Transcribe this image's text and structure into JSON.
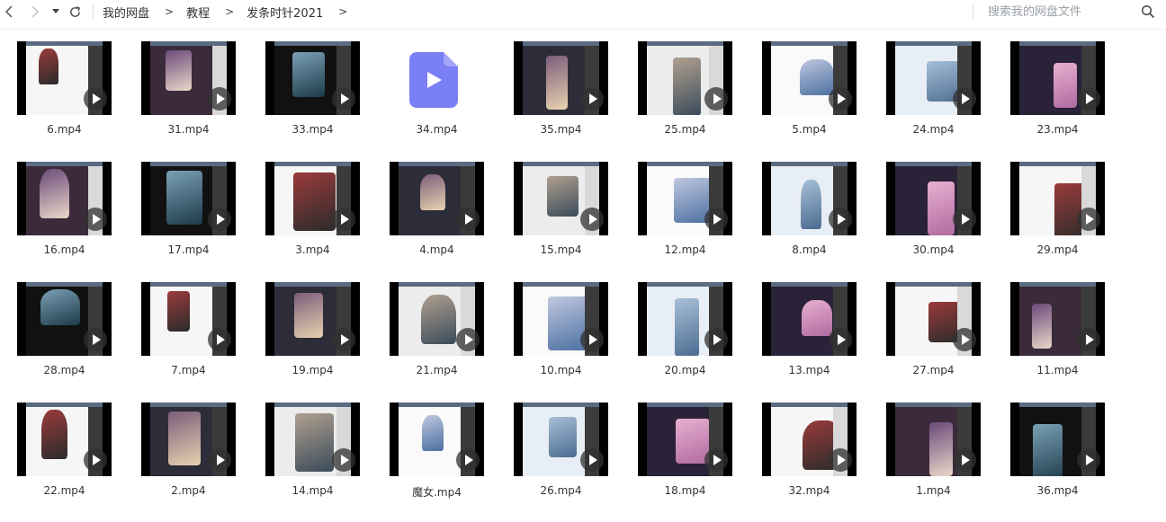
{
  "toolbar": {
    "back_icon": "chevron-left-icon",
    "forward_icon": "chevron-right-icon",
    "history_icon": "caret-down-icon",
    "refresh_icon": "refresh-icon",
    "breadcrumb": [
      "我的网盘",
      "教程",
      "发条时针2021"
    ],
    "breadcrumb_sep": ">",
    "search_placeholder": "搜索我的网盘文件",
    "search_icon": "search-icon"
  },
  "files": [
    {
      "name": "6.mp4",
      "thumb": "video"
    },
    {
      "name": "31.mp4",
      "thumb": "video"
    },
    {
      "name": "33.mp4",
      "thumb": "video"
    },
    {
      "name": "34.mp4",
      "thumb": "icon"
    },
    {
      "name": "35.mp4",
      "thumb": "video"
    },
    {
      "name": "25.mp4",
      "thumb": "video"
    },
    {
      "name": "5.mp4",
      "thumb": "video"
    },
    {
      "name": "24.mp4",
      "thumb": "video"
    },
    {
      "name": "23.mp4",
      "thumb": "video"
    },
    {
      "name": "16.mp4",
      "thumb": "video"
    },
    {
      "name": "17.mp4",
      "thumb": "video"
    },
    {
      "name": "3.mp4",
      "thumb": "video"
    },
    {
      "name": "4.mp4",
      "thumb": "video"
    },
    {
      "name": "15.mp4",
      "thumb": "video"
    },
    {
      "name": "12.mp4",
      "thumb": "video"
    },
    {
      "name": "8.mp4",
      "thumb": "video"
    },
    {
      "name": "30.mp4",
      "thumb": "video"
    },
    {
      "name": "29.mp4",
      "thumb": "video"
    },
    {
      "name": "28.mp4",
      "thumb": "video"
    },
    {
      "name": "7.mp4",
      "thumb": "video"
    },
    {
      "name": "19.mp4",
      "thumb": "video"
    },
    {
      "name": "21.mp4",
      "thumb": "video"
    },
    {
      "name": "10.mp4",
      "thumb": "video"
    },
    {
      "name": "20.mp4",
      "thumb": "video"
    },
    {
      "name": "13.mp4",
      "thumb": "video"
    },
    {
      "name": "27.mp4",
      "thumb": "video"
    },
    {
      "name": "11.mp4",
      "thumb": "video"
    },
    {
      "name": "22.mp4",
      "thumb": "video"
    },
    {
      "name": "2.mp4",
      "thumb": "video"
    },
    {
      "name": "14.mp4",
      "thumb": "video"
    },
    {
      "name": "魔女.mp4",
      "thumb": "video"
    },
    {
      "name": "26.mp4",
      "thumb": "video"
    },
    {
      "name": "18.mp4",
      "thumb": "video"
    },
    {
      "name": "32.mp4",
      "thumb": "video"
    },
    {
      "name": "1.mp4",
      "thumb": "video"
    },
    {
      "name": "36.mp4",
      "thumb": "video"
    }
  ],
  "colors": {
    "video_file_icon": "#7b7ff5",
    "thumbnail_bg": "#000000",
    "play_overlay": "#323232"
  }
}
